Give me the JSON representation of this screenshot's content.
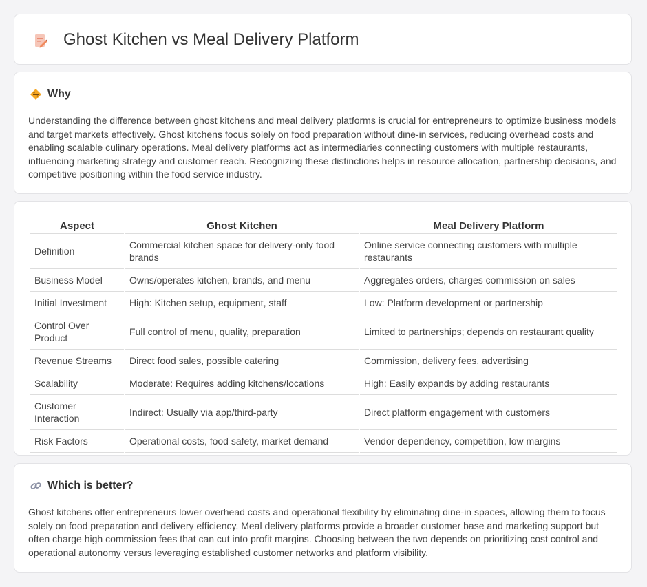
{
  "header": {
    "title": "Ghost Kitchen vs Meal Delivery Platform",
    "icon": "document-pencil-icon"
  },
  "why": {
    "title": "Why",
    "icon": "diamond-warning-icon",
    "text": "Understanding the difference between ghost kitchens and meal delivery platforms is crucial for entrepreneurs to optimize business models and target markets effectively. Ghost kitchens focus solely on food preparation without dine-in services, reducing overhead costs and enabling scalable culinary operations. Meal delivery platforms act as intermediaries connecting customers with multiple restaurants, influencing marketing strategy and customer reach. Recognizing these distinctions helps in resource allocation, partnership decisions, and competitive positioning within the food service industry."
  },
  "table": {
    "headers": [
      "Aspect",
      "Ghost Kitchen",
      "Meal Delivery Platform"
    ],
    "rows": [
      [
        "Definition",
        "Commercial kitchen space for delivery-only food brands",
        "Online service connecting customers with multiple restaurants"
      ],
      [
        "Business Model",
        "Owns/operates kitchen, brands, and menu",
        "Aggregates orders, charges commission on sales"
      ],
      [
        "Initial Investment",
        "High: Kitchen setup, equipment, staff",
        "Low: Platform development or partnership"
      ],
      [
        "Control Over Product",
        "Full control of menu, quality, preparation",
        "Limited to partnerships; depends on restaurant quality"
      ],
      [
        "Revenue Streams",
        "Direct food sales, possible catering",
        "Commission, delivery fees, advertising"
      ],
      [
        "Scalability",
        "Moderate: Requires adding kitchens/locations",
        "High: Easily expands by adding restaurants"
      ],
      [
        "Customer Interaction",
        "Indirect: Usually via app/third-party",
        "Direct platform engagement with customers"
      ],
      [
        "Risk Factors",
        "Operational costs, food safety, market demand",
        "Vendor dependency, competition, low margins"
      ]
    ]
  },
  "better": {
    "title": "Which is better?",
    "icon": "link-icon",
    "text": "Ghost kitchens offer entrepreneurs lower overhead costs and operational flexibility by eliminating dine-in spaces, allowing them to focus solely on food preparation and delivery efficiency. Meal delivery platforms provide a broader customer base and marketing support but often charge high commission fees that can cut into profit margins. Choosing between the two depends on prioritizing cost control and operational autonomy versus leveraging established customer networks and platform visibility."
  }
}
